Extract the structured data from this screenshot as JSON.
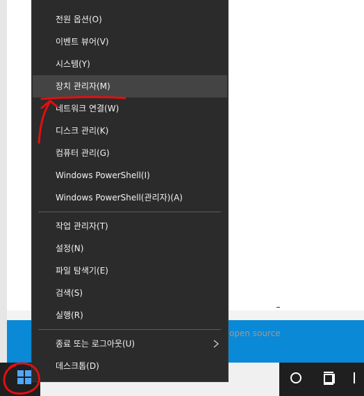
{
  "background": {
    "footer_text": "open source"
  },
  "power_menu": {
    "groups": [
      {
        "items": [
          {
            "label": "전원 옵션(O)"
          },
          {
            "label": "이벤트 뷰어(V)"
          },
          {
            "label": "시스템(Y)"
          },
          {
            "label": "장치 관리자(M)",
            "highlighted": true
          },
          {
            "label": "네트워크 연결(W)"
          },
          {
            "label": "디스크 관리(K)"
          },
          {
            "label": "컴퓨터 관리(G)"
          },
          {
            "label": "Windows PowerShell(I)"
          },
          {
            "label": "Windows PowerShell(관리자)(A)"
          }
        ]
      },
      {
        "items": [
          {
            "label": "작업 관리자(T)"
          },
          {
            "label": "설정(N)"
          },
          {
            "label": "파일 탐색기(E)"
          },
          {
            "label": "검색(S)"
          },
          {
            "label": "실행(R)"
          }
        ]
      },
      {
        "items": [
          {
            "label": "종료 또는 로그아웃(U)",
            "has_submenu": true
          },
          {
            "label": "데스크톱(D)"
          }
        ]
      }
    ]
  },
  "taskbar": {
    "icons": [
      "windows-start-icon",
      "cortana-circle-icon",
      "task-view-icon"
    ]
  },
  "colors": {
    "menu_bg": "#2b2b2b",
    "menu_highlight": "#444444",
    "accent_blue": "#0a89d6",
    "annotation_red": "#e01010"
  }
}
